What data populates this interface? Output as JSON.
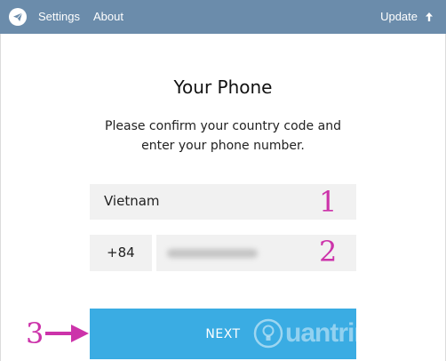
{
  "topbar": {
    "logo_icon": "telegram-paper-plane-icon",
    "settings_label": "Settings",
    "about_label": "About",
    "update_label": "Update",
    "update_icon": "arrow-up-icon",
    "color": "#6b8cab"
  },
  "main": {
    "title": "Your Phone",
    "subtitle_line1": "Please confirm your country code and",
    "subtitle_line2": "enter your phone number.",
    "country_value": "Vietnam",
    "country_code": "+84",
    "next_label": "NEXT",
    "next_color": "#3aace3"
  },
  "annotations": {
    "step1": "1",
    "step2": "2",
    "step3": "3",
    "color": "#cc33aa"
  },
  "watermark": {
    "text": "uantrimang",
    "icon": "lightbulb-icon"
  }
}
